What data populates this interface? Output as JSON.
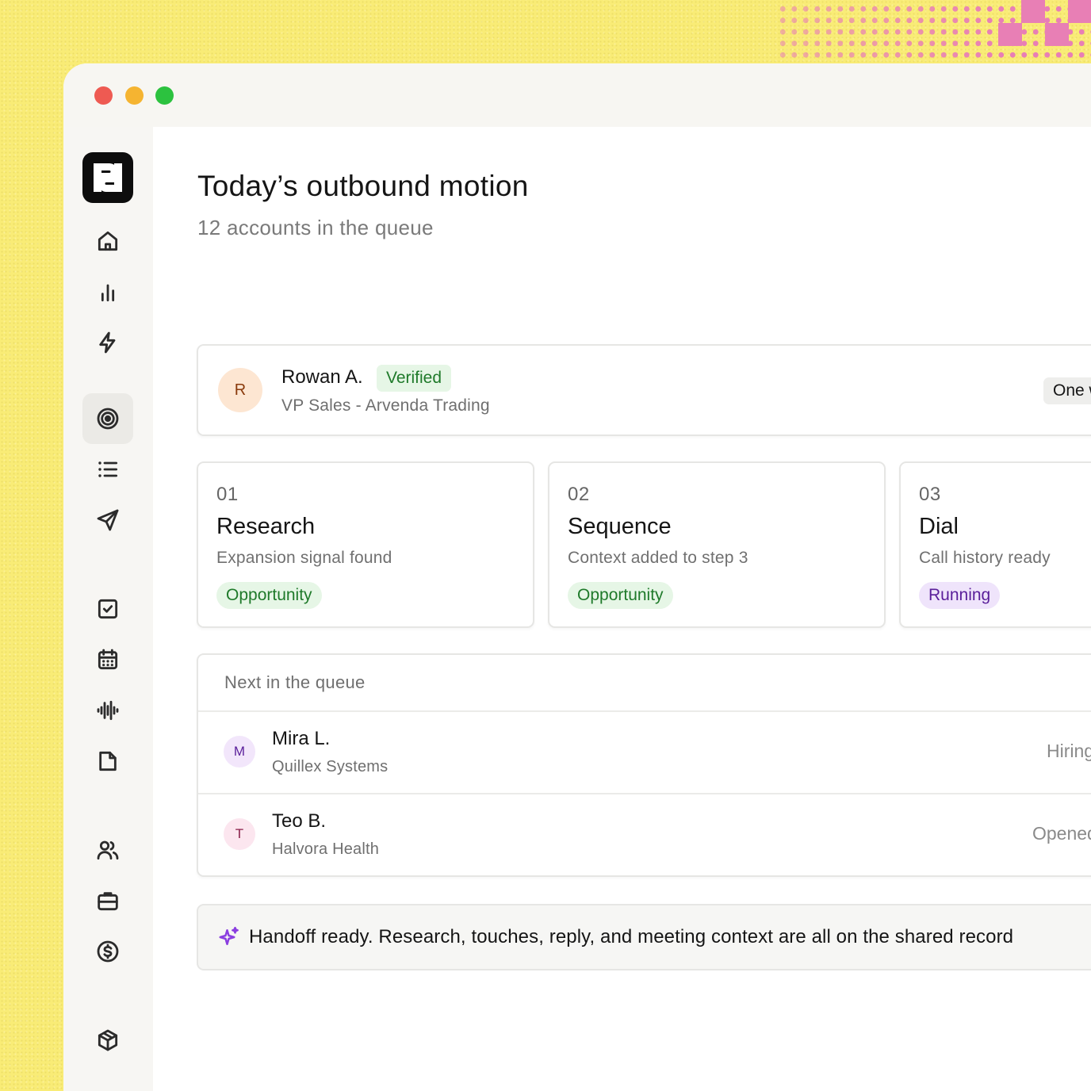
{
  "page": {
    "title": "Today’s outbound motion",
    "subtitle": "12 accounts in the queue"
  },
  "featured_contact": {
    "initial": "R",
    "name": "Rowan A.",
    "badge": "Verified",
    "role": "VP Sales - Arvenda Trading",
    "tag": "One w"
  },
  "steps": [
    {
      "number": "01",
      "title": "Research",
      "description": "Expansion signal found",
      "status": "Opportunity"
    },
    {
      "number": "02",
      "title": "Sequence",
      "description": "Context added to step 3",
      "status": "Opportunity"
    },
    {
      "number": "03",
      "title": "Dial",
      "description": "Call history ready",
      "status": "Running"
    }
  ],
  "queue": {
    "header": "Next in the queue",
    "rows": [
      {
        "initial": "M",
        "name": "Mira L.",
        "company": "Quillex Systems",
        "status": "Hiring"
      },
      {
        "initial": "T",
        "name": "Teo B.",
        "company": "Halvora Health",
        "status": "Opened"
      }
    ]
  },
  "handoff": {
    "strong": "Handoff ready.",
    "text": " Research, touches, reply, and meeting context are all on the shared record"
  },
  "sidebar": {
    "icons": [
      "home-icon",
      "bar-chart-icon",
      "lightning-icon",
      "target-icon",
      "list-icon",
      "send-icon",
      "check-square-icon",
      "calendar-icon",
      "audio-waveform-icon",
      "note-icon",
      "users-icon",
      "briefcase-icon",
      "dollar-icon",
      "cube-icon"
    ],
    "active": "target-icon"
  },
  "colors": {
    "background": "#f9ec76",
    "accent_pink": "#e87fb5",
    "green_badge_text": "#1f7a2a",
    "purple_badge_text": "#5a1f9a",
    "sparkle": "#8b3fe0"
  }
}
